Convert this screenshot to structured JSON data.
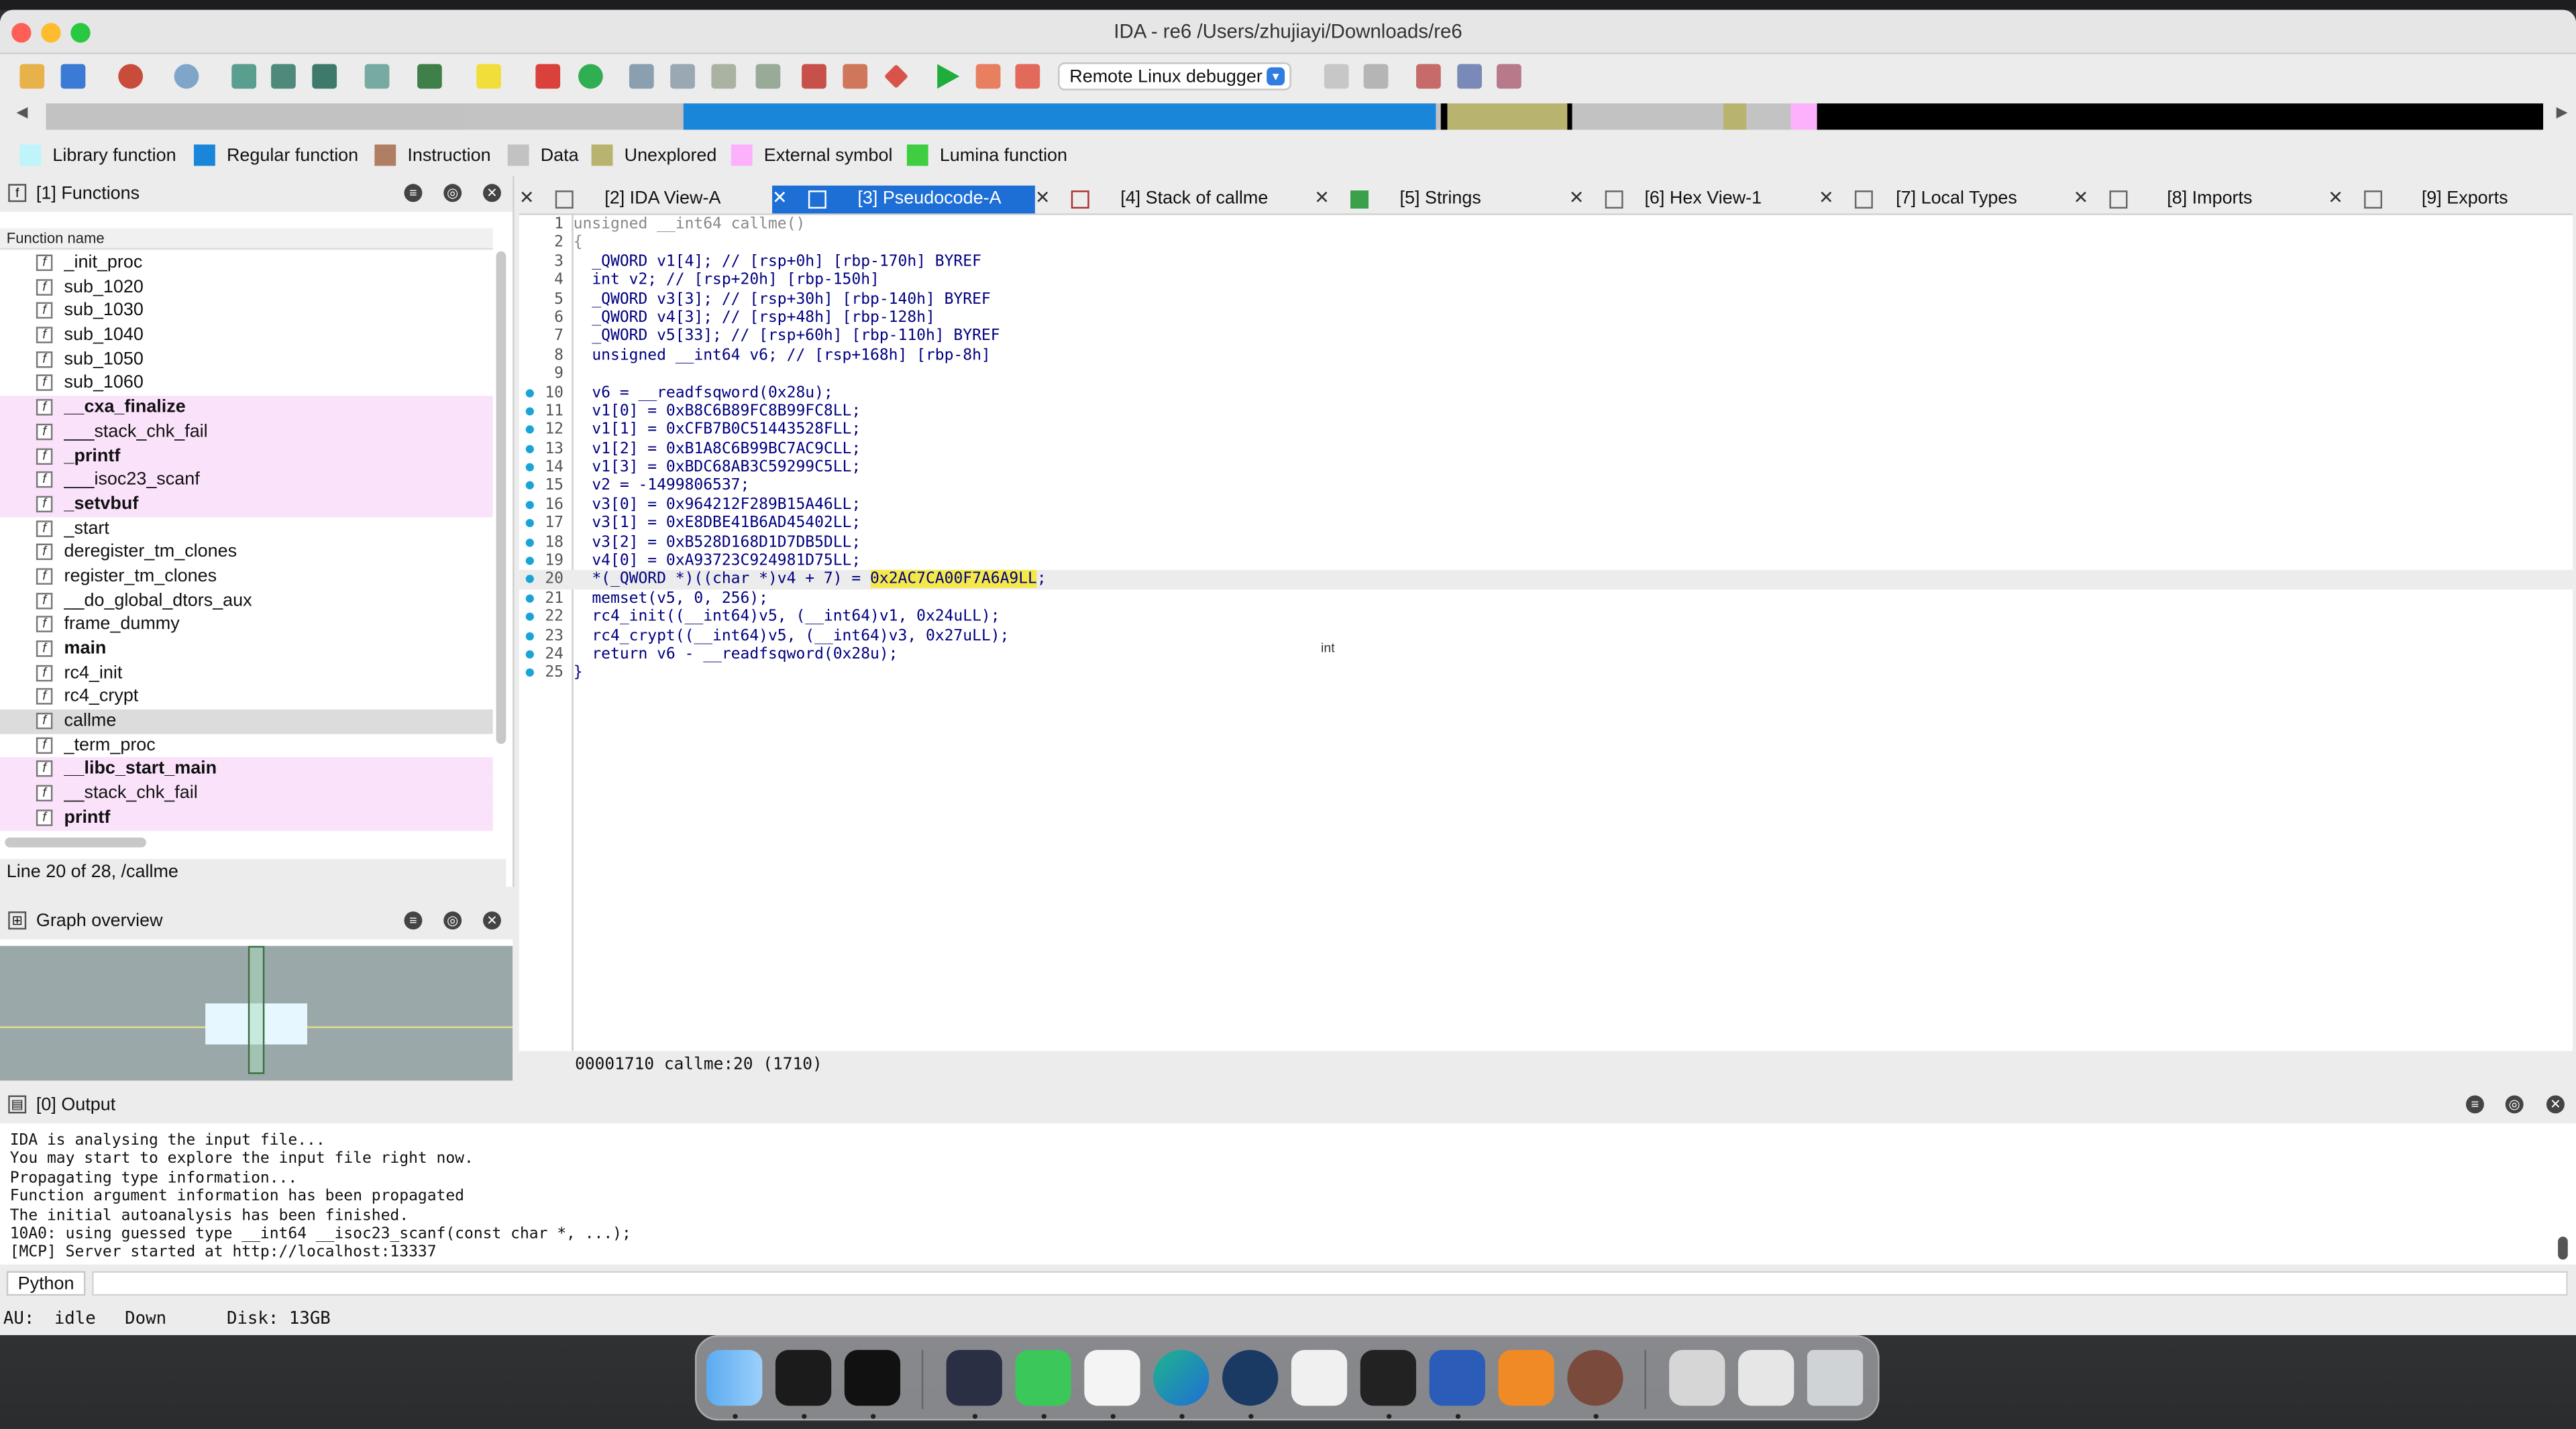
{
  "window": {
    "title": "IDA - re6 /Users/zhujiayi/Downloads/re6"
  },
  "toolbar": {
    "debugger": "Remote Linux debugger"
  },
  "legend": [
    {
      "label": "Library function",
      "color": "#bff4fb"
    },
    {
      "label": "Regular function",
      "color": "#1a86d9"
    },
    {
      "label": "Instruction",
      "color": "#b07e63"
    },
    {
      "label": "Data",
      "color": "#c2c2c2"
    },
    {
      "label": "Unexplored",
      "color": "#b8b36f"
    },
    {
      "label": "External symbol",
      "color": "#fdb1fd"
    },
    {
      "label": "Lumina function",
      "color": "#3fce3f"
    }
  ],
  "functions": {
    "title": "[1] Functions",
    "column": "Function name",
    "items": [
      {
        "name": "_init_proc",
        "kind": "regular"
      },
      {
        "name": "sub_1020",
        "kind": "regular"
      },
      {
        "name": "sub_1030",
        "kind": "regular"
      },
      {
        "name": "sub_1040",
        "kind": "regular"
      },
      {
        "name": "sub_1050",
        "kind": "regular"
      },
      {
        "name": "sub_1060",
        "kind": "regular"
      },
      {
        "name": "__cxa_finalize",
        "kind": "lib-bold"
      },
      {
        "name": "___stack_chk_fail",
        "kind": "lib"
      },
      {
        "name": "_printf",
        "kind": "lib-bold"
      },
      {
        "name": "___isoc23_scanf",
        "kind": "lib"
      },
      {
        "name": "_setvbuf",
        "kind": "lib-bold"
      },
      {
        "name": "_start",
        "kind": "regular"
      },
      {
        "name": "deregister_tm_clones",
        "kind": "regular"
      },
      {
        "name": "register_tm_clones",
        "kind": "regular"
      },
      {
        "name": "__do_global_dtors_aux",
        "kind": "regular"
      },
      {
        "name": "frame_dummy",
        "kind": "regular"
      },
      {
        "name": "main",
        "kind": "bold"
      },
      {
        "name": "rc4_init",
        "kind": "regular"
      },
      {
        "name": "rc4_crypt",
        "kind": "regular"
      },
      {
        "name": "callme",
        "kind": "selected"
      },
      {
        "name": "_term_proc",
        "kind": "regular"
      },
      {
        "name": "__libc_start_main",
        "kind": "lib-bold"
      },
      {
        "name": "__stack_chk_fail",
        "kind": "lib"
      },
      {
        "name": "printf",
        "kind": "lib-bold"
      }
    ],
    "status": "Line 20 of 28, /callme"
  },
  "graph": {
    "title": "Graph overview"
  },
  "tabs": [
    {
      "label": "[2] IDA View-A",
      "active": false
    },
    {
      "label": "[3] Pseudocode-A",
      "active": true
    },
    {
      "label": "[4] Stack of callme",
      "active": false
    },
    {
      "label": "[5] Strings",
      "active": false
    },
    {
      "label": "[6] Hex View-1",
      "active": false
    },
    {
      "label": "[7] Local Types",
      "active": false
    },
    {
      "label": "[8] Imports",
      "active": false
    },
    {
      "label": "[9] Exports",
      "active": false
    }
  ],
  "code": {
    "lines": [
      {
        "n": "1",
        "text": "unsigned __int64 callme()",
        "dot": false
      },
      {
        "n": "2",
        "text": "{",
        "dot": false
      },
      {
        "n": "3",
        "text": "  _QWORD v1[4]; // [rsp+0h] [rbp-170h] BYREF",
        "dot": false
      },
      {
        "n": "4",
        "text": "  int v2; // [rsp+20h] [rbp-150h]",
        "dot": false
      },
      {
        "n": "5",
        "text": "  _QWORD v3[3]; // [rsp+30h] [rbp-140h] BYREF",
        "dot": false
      },
      {
        "n": "6",
        "text": "  _QWORD v4[3]; // [rsp+48h] [rbp-128h]",
        "dot": false
      },
      {
        "n": "7",
        "text": "  _QWORD v5[33]; // [rsp+60h] [rbp-110h] BYREF",
        "dot": false
      },
      {
        "n": "8",
        "text": "  unsigned __int64 v6; // [rsp+168h] [rbp-8h]",
        "dot": false
      },
      {
        "n": "9",
        "text": "",
        "dot": false
      },
      {
        "n": "10",
        "text": "  v6 = __readfsqword(0x28u);",
        "dot": true
      },
      {
        "n": "11",
        "text": "  v1[0] = 0xB8C6B89FC8B99FC8LL;",
        "dot": true
      },
      {
        "n": "12",
        "text": "  v1[1] = 0xCFB7B0C51443528FLL;",
        "dot": true
      },
      {
        "n": "13",
        "text": "  v1[2] = 0xB1A8C6B99BC7AC9CLL;",
        "dot": true
      },
      {
        "n": "14",
        "text": "  v1[3] = 0xBDC68AB3C59299C5LL;",
        "dot": true
      },
      {
        "n": "15",
        "text": "  v2 = -1499806537;",
        "dot": true
      },
      {
        "n": "16",
        "text": "  v3[0] = 0x964212F289B15A46LL;",
        "dot": true
      },
      {
        "n": "17",
        "text": "  v3[1] = 0xE8DBE41B6AD45402LL;",
        "dot": true
      },
      {
        "n": "18",
        "text": "  v3[2] = 0xB528D168D1D7DB5DLL;",
        "dot": true
      },
      {
        "n": "19",
        "text": "  v4[0] = 0xA93723C924981D75LL;",
        "dot": true
      },
      {
        "n": "20",
        "text": "  *(_QWORD *)((char *)v4 + 7) = ",
        "hl": "0x2AC7CA00F7A6A9LL",
        "tail": ";",
        "dot": true
      },
      {
        "n": "21",
        "text": "  memset(v5, 0, 256);",
        "dot": true
      },
      {
        "n": "22",
        "text": "  rc4_init((__int64)v5, (__int64)v1, 0x24uLL);",
        "dot": true
      },
      {
        "n": "23",
        "text": "  rc4_crypt((__int64)v5, (__int64)v3, 0x27uLL);",
        "dot": true
      },
      {
        "n": "24",
        "text": "  return v6 - __readfsqword(0x28u);",
        "dot": true
      },
      {
        "n": "25",
        "text": "}",
        "dot": true
      }
    ],
    "tooltip": "int",
    "status": "00001710 callme:20 (1710)"
  },
  "output": {
    "title": "[0] Output",
    "lines": [
      "IDA is analysing the input file...",
      "You may start to explore the input file right now.",
      "Propagating type information...",
      "Function argument information has been propagated",
      "The initial autoanalysis has been finished.",
      "10A0: using guessed type __int64 __isoc23_scanf(const char *, ...);",
      "[MCP] Server started at http://localhost:13337"
    ],
    "python_label": "Python"
  },
  "status": {
    "au_label": "AU:",
    "au_state": "idle",
    "direction": "Down",
    "disk": "Disk: 13GB"
  },
  "dock": {
    "apps": [
      "finder-icon",
      "activity-monitor-icon",
      "terminal-icon",
      "vmware-icon",
      "wechat-icon",
      "typora-icon",
      "edge-icon",
      "steam-icon",
      "textedit-icon",
      "ida-cube-icon",
      "word-icon",
      "yuque-icon",
      "ida-portrait-icon",
      "preview-icon",
      "screenshot-icon",
      "trash-icon"
    ]
  }
}
